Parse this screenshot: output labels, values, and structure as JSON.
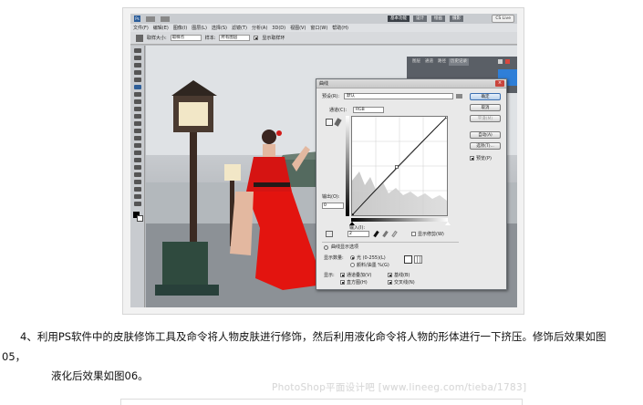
{
  "photoshop": {
    "workspace_tabs": [
      "基本功能",
      "设计",
      "绘画",
      "摄影"
    ],
    "cs_live": "CS Live",
    "menu_items": [
      "文件(F)",
      "编辑(E)",
      "图像(I)",
      "图层(L)",
      "选择(S)",
      "滤镜(T)",
      "分析(A)",
      "3D(D)",
      "视图(V)",
      "窗口(W)",
      "帮助(H)"
    ],
    "options_bar": {
      "sample_label": "取样大小:",
      "sample_value": "取样点",
      "layers_label": "样本:",
      "layers_value": "所有图层",
      "ring_label": "显示取样环"
    },
    "panel_tabs": [
      "图层",
      "通道",
      "路径",
      "历史记录"
    ],
    "curves_dialog": {
      "title": "曲线",
      "preset_label": "预设(R):",
      "preset_value": "默认",
      "channel_label": "通道(C):",
      "channel_value": "RGB",
      "output_label": "输出(O):",
      "output_value": "0",
      "input_label": "输入(I):",
      "input_value": "2",
      "show_clipping": "显示修剪(W)",
      "display_options": "曲线显示选项",
      "show_amount_label": "显示数量:",
      "light_option": "光 (0-255)(L)",
      "pigment_option": "颜料/油墨 %(G)",
      "show_label": "显示:",
      "channel_overlays": "通道叠加(V)",
      "baseline": "基线(B)",
      "histogram": "直方图(H)",
      "intersection": "交叉线(N)",
      "buttons": {
        "ok": "确定",
        "cancel": "取消",
        "smooth": "平滑(M)",
        "auto": "自动(A)",
        "options": "选项(T)...",
        "preview": "预览(P)"
      },
      "curve_points": [
        [
          0,
          0
        ],
        [
          47,
          49
        ],
        [
          100,
          100
        ]
      ]
    }
  },
  "article": {
    "step_text": "4、利用PS软件中的皮肤修饰工具及命令将人物皮肤进行修饰，然后利用液化命令将人物的形体进行一下挤压。修饰后效果如图",
    "step_text_cont": "05，",
    "liquify_text": "液化后效果如图06。",
    "watermark": "PhotoShop平面设计吧 [www.lineeg.com/tieba/1783]"
  }
}
